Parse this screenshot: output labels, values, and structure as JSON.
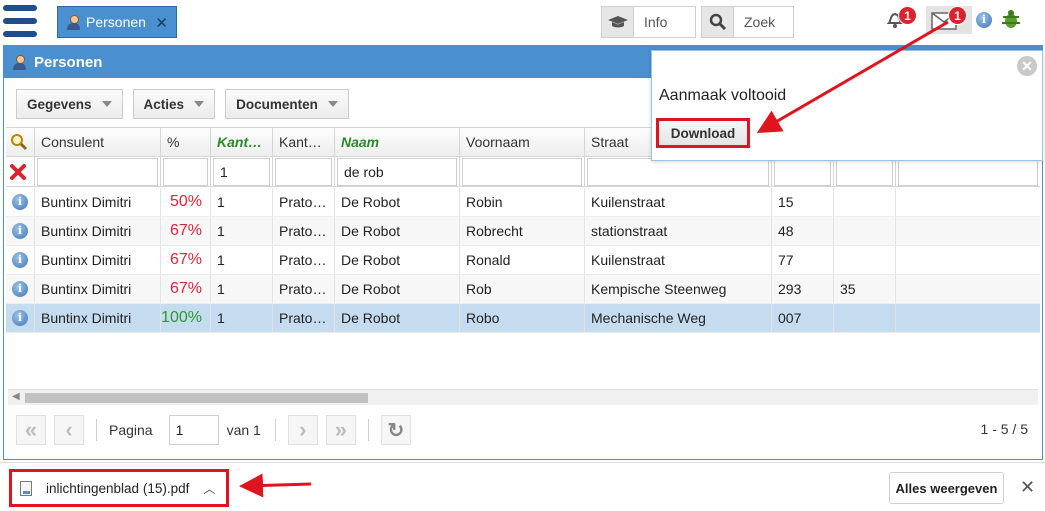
{
  "tab": {
    "label": "Personen",
    "close": "✕"
  },
  "toolbar_right": {
    "info_label": "Info",
    "search_label": "Zoek",
    "notifications_count": "1",
    "messages_count": "1"
  },
  "panel": {
    "title": "Personen",
    "buttons": {
      "gegevens": "Gegevens",
      "acties": "Acties",
      "documenten": "Documenten"
    }
  },
  "grid": {
    "headers": [
      "Consulent",
      "%",
      "Kant…",
      "Kant…",
      "Naam",
      "Voornaam",
      "Straat"
    ],
    "filters": {
      "kantoor": "1",
      "naam": "de rob"
    },
    "rows": [
      {
        "consulent": "Buntinx Dimitri",
        "pct": "50%",
        "k1": "1",
        "k2": "Prato…",
        "naam": "De Robot",
        "voornaam": "Robin",
        "straat": "Kuilenstraat",
        "nr": "15",
        "bus": ""
      },
      {
        "consulent": "Buntinx Dimitri",
        "pct": "67%",
        "k1": "1",
        "k2": "Prato…",
        "naam": "De Robot",
        "voornaam": "Robrecht",
        "straat": "stationstraat",
        "nr": "48",
        "bus": ""
      },
      {
        "consulent": "Buntinx Dimitri",
        "pct": "67%",
        "k1": "1",
        "k2": "Prato…",
        "naam": "De Robot",
        "voornaam": "Ronald",
        "straat": "Kuilenstraat",
        "nr": "77",
        "bus": ""
      },
      {
        "consulent": "Buntinx Dimitri",
        "pct": "67%",
        "k1": "1",
        "k2": "Prato…",
        "naam": "De Robot",
        "voornaam": "Rob",
        "straat": "Kempische Steenweg",
        "nr": "293",
        "bus": "35"
      },
      {
        "consulent": "Buntinx Dimitri",
        "pct": "100%",
        "k1": "1",
        "k2": "Prato…",
        "naam": "De Robot",
        "voornaam": "Robo",
        "straat": "Mechanische Weg",
        "nr": "007",
        "bus": ""
      }
    ]
  },
  "pager": {
    "page_label": "Pagina",
    "page_value": "1",
    "of_label": "van 1",
    "count": "1 - 5 / 5"
  },
  "popover": {
    "message": "Aanmaak voltooid",
    "download": "Download"
  },
  "download_bar": {
    "filename": "inlichtingenblad (15).pdf",
    "show_all": "Alles weergeven"
  },
  "colors": {
    "accent": "#4a8fd0",
    "pct_red": "#e0243a",
    "pct_green": "#2a9a2a",
    "highlight": "#e0141e"
  }
}
